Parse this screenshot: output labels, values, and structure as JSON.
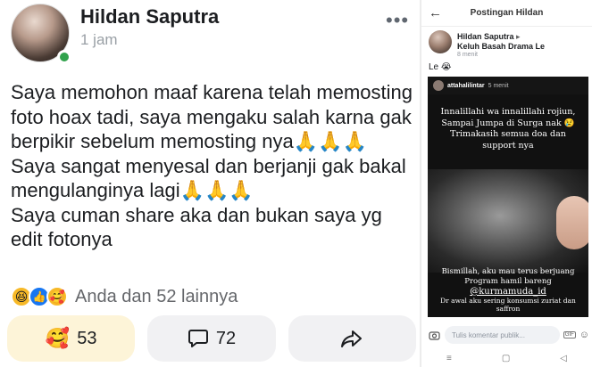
{
  "post": {
    "author": "Hildan Saputra",
    "time": "1 jam",
    "menu_icon": "more-dots",
    "text_lines": [
      "Saya memohon maaf karena telah memosting foto hoax tadi, saya mengaku salah karna gak berpikir sebelum memosting nya🙏🙏🙏",
      "Saya sangat menyesal dan berjanji gak bakal mengulanginya lagi🙏🙏🙏",
      "Saya cuman share aka dan bukan saya yg edit fotonya"
    ],
    "reactions": {
      "icons": [
        "😆",
        "👍",
        "🥰"
      ],
      "summary": "Anda dan 52 lainnya"
    },
    "actions": {
      "react_emoji": "🥰",
      "react_count": "53",
      "comment_count": "72"
    }
  },
  "phone": {
    "header_title": "Postingan Hildan",
    "author": "Hildan Saputra",
    "arrow": "▸",
    "group": "Keluh Basah Drama Le",
    "time": "8 menit",
    "caption": "Le 😭",
    "story": {
      "username": "attahalilintar",
      "time": "5 menit",
      "text_top": "Innalillahi wa innalillahi rojiun, Sampai Jumpa di Surga nak 😢 Trimakasih semua doa dan support nya",
      "text_bottom_1": "Bismillah, aku mau terus berjuang Program hamil bareng",
      "mention": "@kurmamuda_id",
      "text_bottom_2": "Dr awal aku sering konsumsi zuriat dan saffron"
    },
    "comment_placeholder": "Tulis komentar publik...",
    "gif_label": "GIF"
  },
  "colors": {
    "online": "#31a24c",
    "like_blue": "#1877f2",
    "active_react_bg": "#fdf4d8"
  }
}
